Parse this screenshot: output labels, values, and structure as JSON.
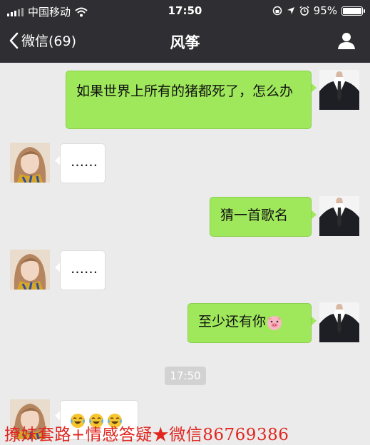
{
  "status_bar": {
    "carrier": "中国移动",
    "time": "17:50",
    "battery": "95%",
    "battery_level": 0.95
  },
  "nav": {
    "back_label": "微信(69)",
    "title": "风筝"
  },
  "messages": [
    {
      "side": "right",
      "text": "如果世界上所有的猪都死了，怎么办"
    },
    {
      "side": "left",
      "text": "……"
    },
    {
      "side": "right",
      "text": "猜一首歌名"
    },
    {
      "side": "left",
      "text": "……"
    },
    {
      "side": "right",
      "text": "至少还有你"
    },
    {
      "side": "left",
      "emoji": "crying-laughing-emoji x3"
    }
  ],
  "timestamp": "17:50",
  "watermark": "撩妹套路+情感答疑★微信86769386",
  "colors": {
    "bar": "#2f2f33",
    "background": "#ebebeb",
    "sent_bubble": "#9fe85b",
    "received_bubble": "#ffffff",
    "watermark": "#e0261f"
  }
}
